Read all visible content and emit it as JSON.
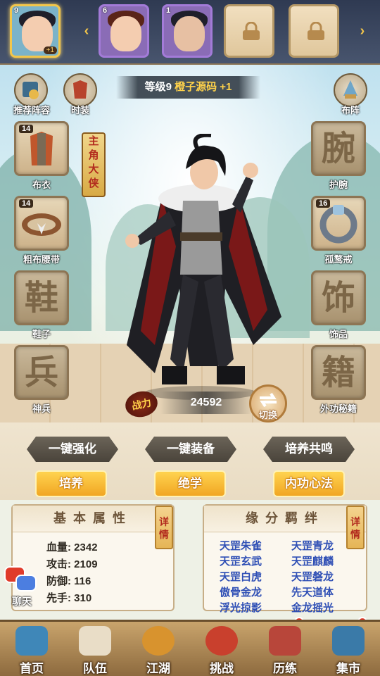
{
  "top_bar": {
    "heroes": [
      {
        "level": "9",
        "bonus": "+1"
      },
      {
        "level": "6"
      },
      {
        "level": "1"
      }
    ]
  },
  "header": {
    "level_label": "等级9",
    "player_name": "橙子源码",
    "bonus": "+1"
  },
  "left_buttons": {
    "recommend": "推荐阵容",
    "fashion": "时装"
  },
  "right_buttons": {
    "formation": "布阵"
  },
  "banner": [
    "主",
    "角",
    "大",
    "侠"
  ],
  "equipment": {
    "left": [
      {
        "level": "14",
        "label": "布衣"
      },
      {
        "level": "14",
        "label": "粗布腰带"
      },
      {
        "label": "鞋子",
        "glyph": "鞋"
      },
      {
        "label": "神兵",
        "glyph": "兵"
      }
    ],
    "right": [
      {
        "label": "护腕",
        "glyph": "腕"
      },
      {
        "level": "16",
        "label": "孤鹜戒"
      },
      {
        "label": "饰品",
        "glyph": "饰"
      },
      {
        "label": "外功秘籍",
        "glyph": "籍"
      }
    ]
  },
  "power": {
    "label": "战力",
    "value": "24592",
    "switch_label": "切换"
  },
  "actions": {
    "auto_enhance": "一键强化",
    "auto_equip": "一键装备",
    "resonance": "培养共鸣"
  },
  "tabs": {
    "cultivate": "培养",
    "skills": "绝学",
    "inner": "内功心法"
  },
  "attributes": {
    "title": "基本属性",
    "detail": "详情",
    "stats": [
      {
        "text": "血量: 2342"
      },
      {
        "text": "攻击: 2109"
      },
      {
        "text": "防御: 116"
      },
      {
        "text": "先手: 310"
      }
    ]
  },
  "bonds": {
    "title": "缘分羁绊",
    "detail": "详情",
    "left": [
      "天罡朱雀",
      "天罡玄武",
      "天罡白虎",
      "傲骨金龙",
      "浮光掠影"
    ],
    "right": [
      "天罡青龙",
      "天罡麒麟",
      "天罡磐龙",
      "先天道体",
      "金龙摇光"
    ]
  },
  "chat": {
    "label": "聊天"
  },
  "nav": [
    {
      "label": "首页"
    },
    {
      "label": "队伍"
    },
    {
      "label": "江湖"
    },
    {
      "label": "挑战"
    },
    {
      "label": "历练"
    },
    {
      "label": "集市"
    }
  ],
  "colors": {
    "accent_gold": "#ffd24a",
    "bond_blue": "#2f4fb5",
    "tab_orange": "#f1a623",
    "alert_red": "#e83a2a"
  }
}
